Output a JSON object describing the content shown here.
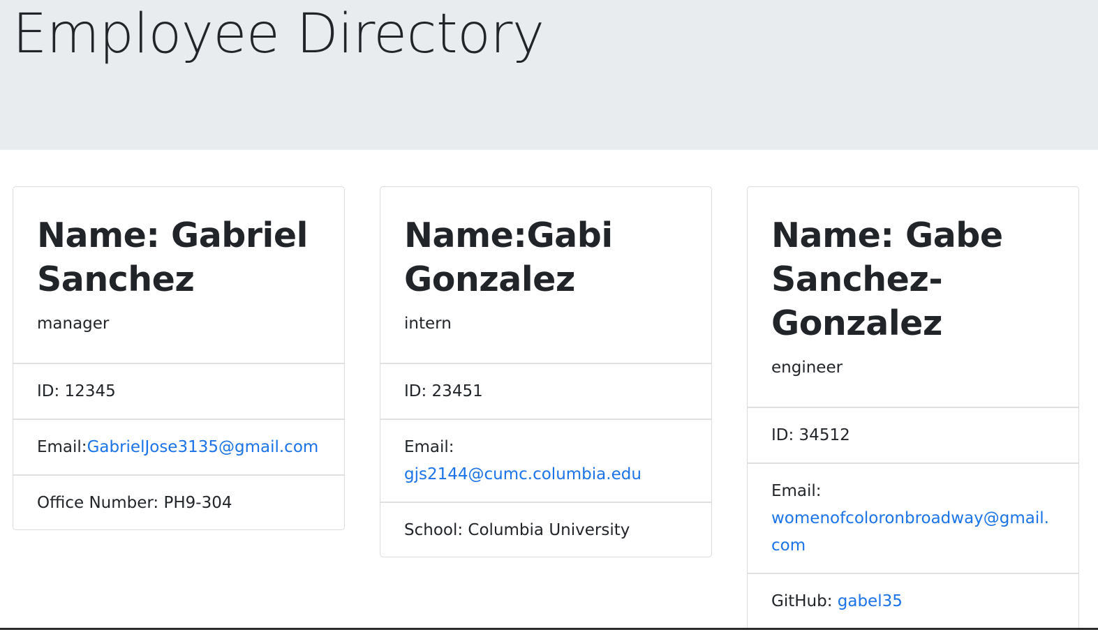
{
  "header": {
    "title": "Employee Directory"
  },
  "employees": [
    {
      "name": "Name: Gabriel Sanchez",
      "role": "manager",
      "id": "ID: 12345",
      "email_label": "Email:",
      "email": "GabrielJose3135@gmail.com",
      "extra_label": "Office Number: PH9-304"
    },
    {
      "name": "Name:Gabi Gonzalez",
      "role": "intern",
      "id": "ID: 23451",
      "email_label": "Email:",
      "email": "gjs2144@cumc.columbia.edu",
      "extra_label": "School: Columbia University"
    },
    {
      "name": "Name: Gabe Sanchez-Gonzalez",
      "role": "engineer",
      "id": "ID: 34512",
      "email_label": "Email:",
      "email_line1": "womenofcoloronbroadway@gmail.",
      "email_line2": "com",
      "extra_label": "GitHub: ",
      "github": "gabel35"
    }
  ],
  "colors": {
    "header_bg": "#e9ecef",
    "link": "#1a73e8",
    "text": "#212529"
  }
}
